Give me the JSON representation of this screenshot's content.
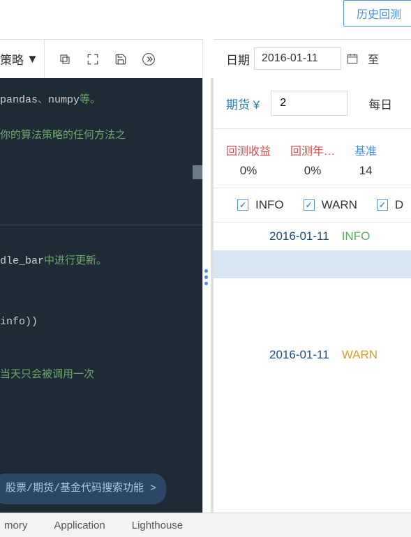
{
  "header": {
    "history_btn": "历史回测"
  },
  "left": {
    "strategy_label": "策略",
    "code": {
      "l1a": "pandas",
      "l1b": "、",
      "l1c": "numpy",
      "l1d": "等。",
      "l2": "你的算法策略的任何方法之",
      "l3a": "dle_bar",
      "l3b": "中进行更新。",
      "l4": "info))",
      "l5": "当天只会被调用一次"
    },
    "search_btn": "股票/期货/基金代码搜索功能 >"
  },
  "right": {
    "date_label": "日期",
    "date_value": "2016-01-11",
    "to": "至",
    "futures_label": "期货 ¥",
    "futures_value": "2",
    "daily": "每日",
    "metrics": [
      {
        "label": "回测收益",
        "value": "0%",
        "cls": "m-red"
      },
      {
        "label": "回测年…",
        "value": "0%",
        "cls": "m-red"
      },
      {
        "label": "基准",
        "value": "14",
        "cls": "m-blue"
      }
    ],
    "filters": {
      "info": "INFO",
      "warn": "WARN",
      "d": "D"
    },
    "logs": [
      {
        "date": "2016-01-11",
        "level": "INFO",
        "lvl_cls": "lvl-info"
      },
      {
        "date": "2016-01-11",
        "level": "WARN",
        "lvl_cls": "lvl-warn"
      }
    ]
  },
  "devtabs": {
    "memory": "mory",
    "application": "Application",
    "lighthouse": "Lighthouse"
  }
}
